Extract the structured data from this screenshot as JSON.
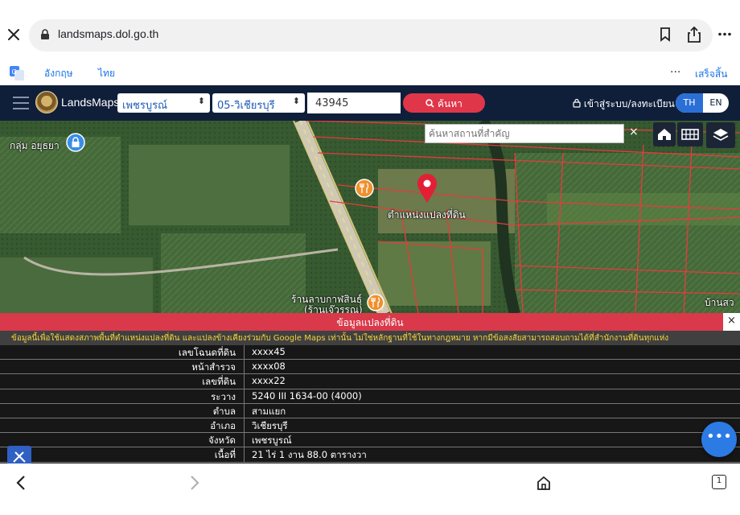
{
  "browser": {
    "url": "landsmaps.dol.go.th",
    "icons": [
      "close-icon",
      "lock-icon",
      "bookmark-icon",
      "share-icon",
      "more-icon"
    ]
  },
  "translate": {
    "tab_english": "อังกฤษ",
    "tab_thai": "ไทย",
    "more": "···",
    "done": "เสร็จสิ้น"
  },
  "header": {
    "brand": "LandsMaps",
    "province": "เพชรบูรณ์",
    "district": "05-วิเชียรบุรี",
    "parcel_no": "43945",
    "search_label": "ค้นหา",
    "login_label": "เข้าสู่ระบบ/ลงทะเบียน",
    "lang_th": "TH",
    "lang_en": "EN",
    "accent_color": "#e0364a",
    "bar_color": "#0f1f3a"
  },
  "map": {
    "place_search_placeholder": "ค้นหาสถานที่สำคัญ",
    "clear": "×",
    "labels": {
      "village": "กลุ่ม อยุธยา",
      "parcel_marker": "ตำแหน่งแปลงที่ดิน",
      "shop_line1": "ร้านลาบกาฬสินธุ์",
      "shop_line2": "(ร้านเจ๊วรรณ)",
      "right_edge": "บ้านสว"
    }
  },
  "info": {
    "title": "ข้อมูลแปลงที่ดิน",
    "close": "×",
    "disclaimer": "ข้อมูลนี้เพื่อใช้แสดงสภาพพื้นที่ตำแหน่งแปลงที่ดิน และแปลงข้างเคียงร่วมกับ Google Maps เท่านั้น ไม่ใช่หลักฐานที่ใช้ในทางกฎหมาย หากมีข้อสงสัยสามารถสอบถามได้ที่สำนักงานที่ดินทุกแห่ง",
    "rows": [
      {
        "key": "เลขโฉนดที่ดิน",
        "value": "xxxx45"
      },
      {
        "key": "หน้าสำรวจ",
        "value": "xxxx08"
      },
      {
        "key": "เลขที่ดิน",
        "value": "xxxx22"
      },
      {
        "key": "ระวาง",
        "value": "5240 III 1634-00 (4000)"
      },
      {
        "key": "ตำบล",
        "value": "สามแยก"
      },
      {
        "key": "อำเภอ",
        "value": "วิเชียรบุรี"
      },
      {
        "key": "จังหวัด",
        "value": "เพชรบูรณ์"
      },
      {
        "key": "เนื้อที่",
        "value": "21 ไร่ 1 งาน 88.0 ตารางวา"
      }
    ]
  },
  "fab_label": "•••",
  "bottom_nav": {
    "tab_count": "1",
    "icons": [
      "back-icon",
      "forward-icon",
      "home-icon",
      "tabs-icon"
    ]
  }
}
